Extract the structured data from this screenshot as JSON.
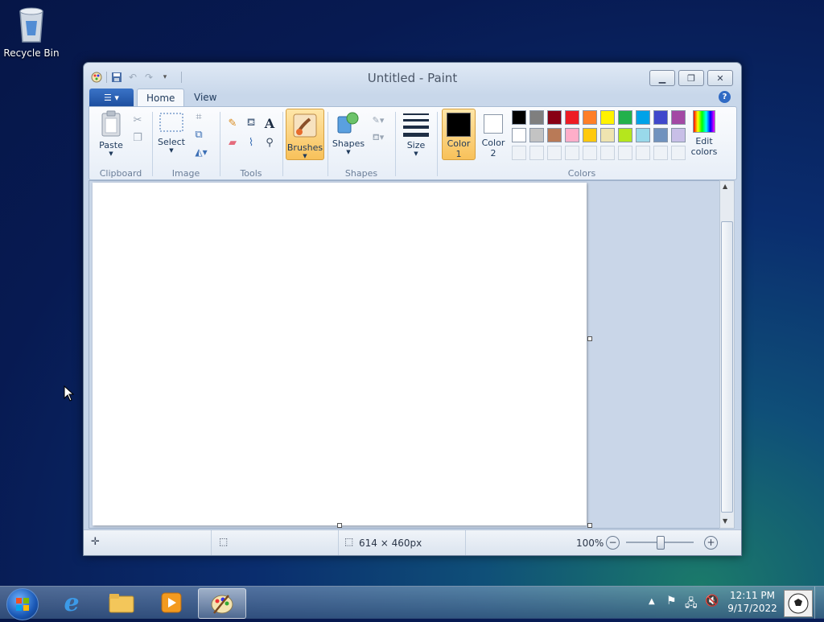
{
  "desktop": {
    "recycle_bin_label": "Recycle Bin"
  },
  "window": {
    "title": "Untitled - Paint",
    "tabs": [
      {
        "label": "Home"
      },
      {
        "label": "View"
      }
    ],
    "help_glyph": "?"
  },
  "ribbon": {
    "groups": {
      "clipboard": "Clipboard",
      "image": "Image",
      "tools": "Tools",
      "shapes": "Shapes",
      "colors": "Colors"
    },
    "buttons": {
      "paste": "Paste",
      "select": "Select",
      "brushes": "Brushes",
      "shapes": "Shapes",
      "size": "Size",
      "color1_line1": "Color",
      "color1_line2": "1",
      "color2_line1": "Color",
      "color2_line2": "2",
      "edit_colors_line1": "Edit",
      "edit_colors_line2": "colors"
    },
    "palette_row1": [
      "#000000",
      "#7f7f7f",
      "#880015",
      "#ed1c24",
      "#ff7f27",
      "#fff200",
      "#22b14c",
      "#00a2e8",
      "#3f48cc",
      "#a349a4"
    ],
    "palette_row2": [
      "#ffffff",
      "#c3c3c3",
      "#b97a57",
      "#ffaec9",
      "#ffc90e",
      "#efe4b0",
      "#b5e61d",
      "#99d9ea",
      "#7092be",
      "#c8bfe7"
    ],
    "accent_color": "#f8c15a"
  },
  "status": {
    "dimensions": "614 × 460px",
    "zoom": "100%"
  },
  "taskbar": {
    "time": "12:11 PM",
    "date": "9/17/2022"
  }
}
